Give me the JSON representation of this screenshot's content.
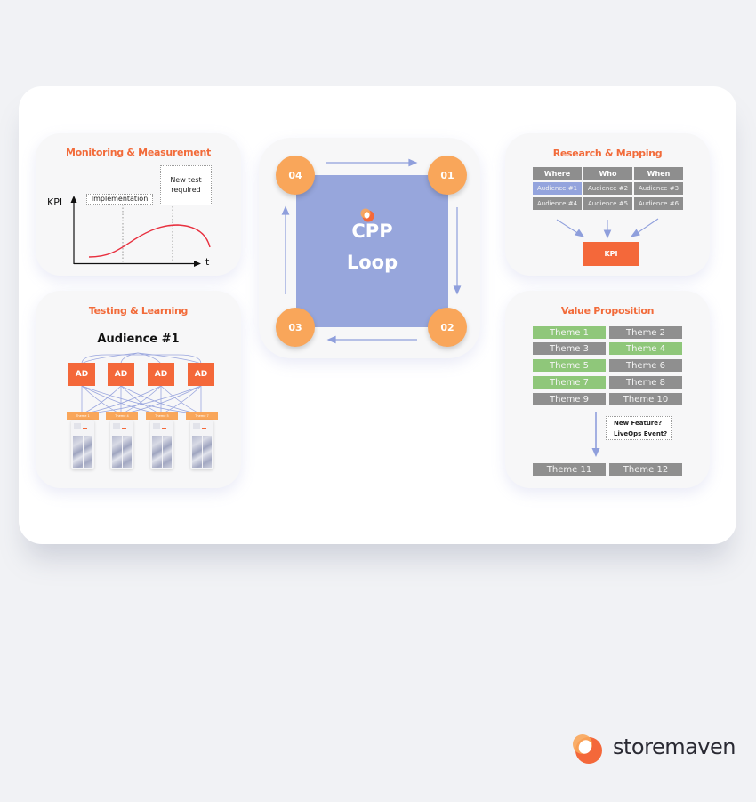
{
  "diagram": {
    "center": {
      "title_line1": "CPP",
      "title_line2": "Loop",
      "nodes": [
        {
          "id": "04",
          "label": "04"
        },
        {
          "id": "01",
          "label": "01"
        },
        {
          "id": "02",
          "label": "02"
        },
        {
          "id": "03",
          "label": "03"
        }
      ],
      "flow": "04 → 01 → 02 → 03 → 04 (clockwise)"
    },
    "monitoring": {
      "title": "Monitoring & Measurement",
      "y_label": "KPI",
      "x_label": "t",
      "annotation_implementation": "Implementation",
      "annotation_new_test_line1": "New test",
      "annotation_new_test_line2": "required"
    },
    "testing": {
      "title": "Testing & Learning",
      "audience": "Audience #1",
      "ads": [
        "AD",
        "AD",
        "AD",
        "AD"
      ],
      "themes": [
        "Theme 1",
        "Theme 4",
        "Theme 5",
        "Theme 7"
      ]
    },
    "research": {
      "title": "Research & Mapping",
      "headers": [
        "Where",
        "Who",
        "When"
      ],
      "rows": [
        [
          "Audience #1",
          "Audience #2",
          "Audience #3"
        ],
        [
          "Audience #4",
          "Audience #5",
          "Audience #6"
        ]
      ],
      "highlighted": "Audience #1",
      "target": "KPI"
    },
    "value": {
      "title": "Value Proposition",
      "themes": [
        {
          "label": "Theme 1",
          "selected": true
        },
        {
          "label": "Theme 2",
          "selected": false
        },
        {
          "label": "Theme 3",
          "selected": false
        },
        {
          "label": "Theme 4",
          "selected": true
        },
        {
          "label": "Theme 5",
          "selected": true
        },
        {
          "label": "Theme 6",
          "selected": false
        },
        {
          "label": "Theme 7",
          "selected": true
        },
        {
          "label": "Theme 8",
          "selected": false
        },
        {
          "label": "Theme 9",
          "selected": false
        },
        {
          "label": "Theme 10",
          "selected": false
        }
      ],
      "triggers": [
        "New Feature?",
        "LiveOps Event?"
      ],
      "new_themes": [
        "Theme 11",
        "Theme 12"
      ]
    }
  },
  "colors": {
    "accent_orange": "#f4683a",
    "node_orange": "#f9a65a",
    "loop_blue": "#97a6dc",
    "selected_green": "#8fc77a",
    "neutral_gray": "#8f8f8f",
    "curve_red": "#e8303f"
  },
  "brand": {
    "name": "storemaven",
    "icon": "storemaven-logo-icon"
  }
}
